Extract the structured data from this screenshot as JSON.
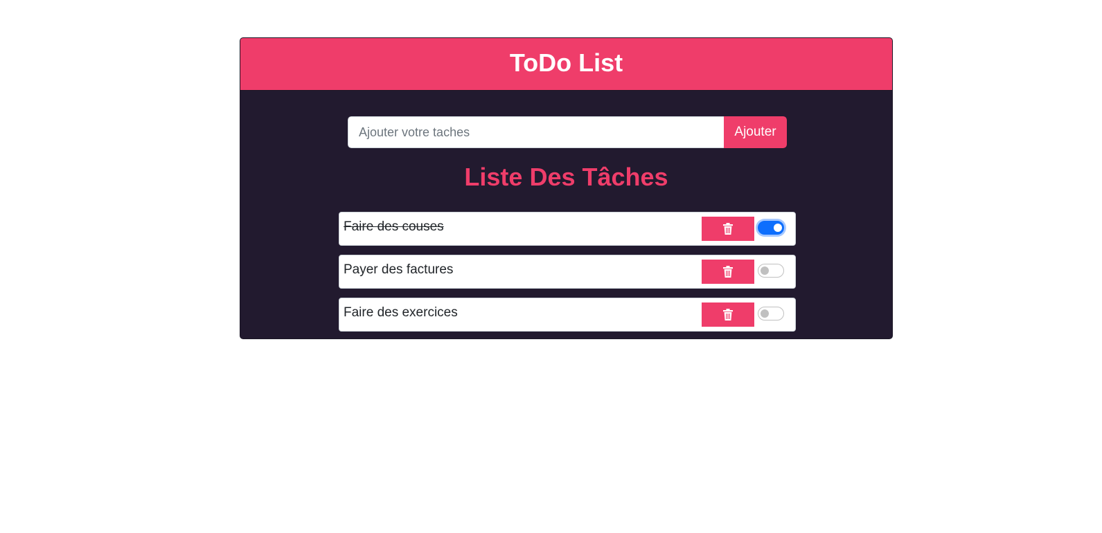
{
  "header": {
    "title": "ToDo List"
  },
  "add_form": {
    "placeholder": "Ajouter votre taches",
    "value": "",
    "button_label": "Ajouter"
  },
  "list": {
    "title": "Liste Des Tâches",
    "tasks": [
      {
        "label": "Faire des couses",
        "done": true,
        "delete_icon": "trash-icon"
      },
      {
        "label": "Payer des factures",
        "done": false,
        "delete_icon": "trash-icon"
      },
      {
        "label": "Faire des exercices",
        "done": false,
        "delete_icon": "trash-icon"
      }
    ]
  },
  "colors": {
    "accent": "#ef3d6a",
    "panel_background": "#221a2f",
    "switch_on": "#0d6efd"
  }
}
